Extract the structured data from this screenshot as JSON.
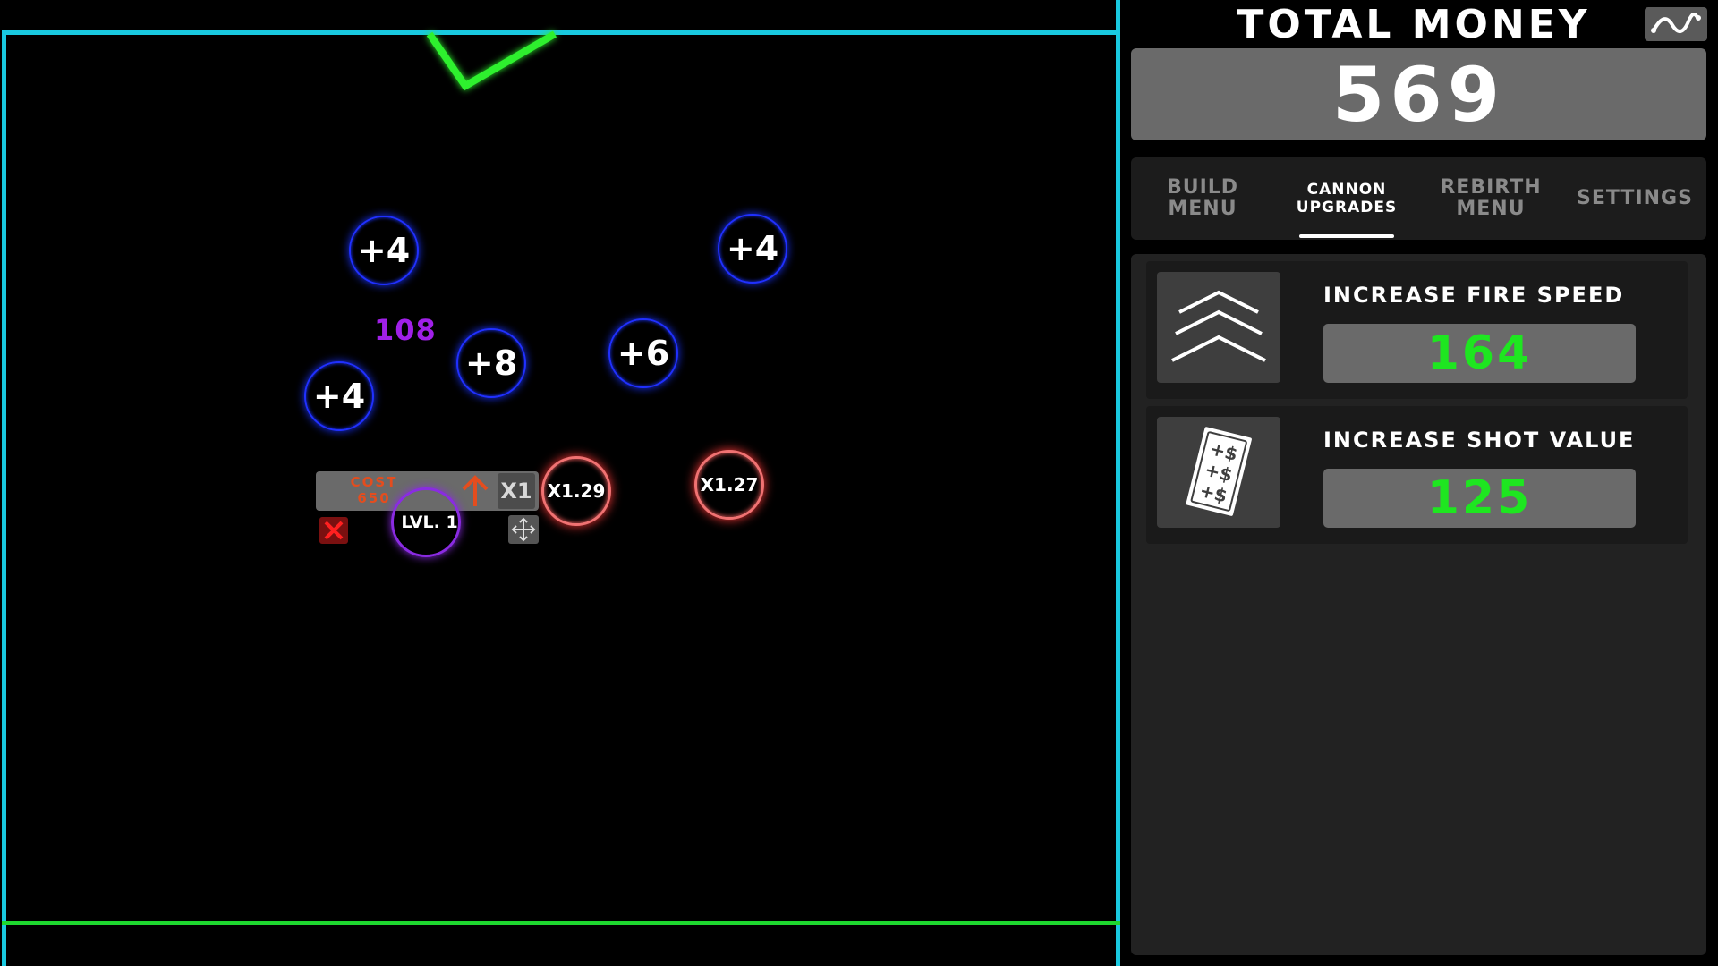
{
  "header": {
    "title": "TOTAL MONEY",
    "money": "569",
    "graph_icon": "stats-graph-icon"
  },
  "tabs": [
    {
      "label_line1": "BUILD",
      "label_line2": "MENU",
      "active": false
    },
    {
      "label_line1": "CANNON",
      "label_line2": "UPGRADES",
      "active": true
    },
    {
      "label_line1": "REBIRTH",
      "label_line2": "MENU",
      "active": false
    },
    {
      "label_line1": "SETTINGS",
      "label_line2": "",
      "active": false
    }
  ],
  "upgrades": [
    {
      "title": "INCREASE FIRE SPEED",
      "price": "164",
      "icon": "triple-chevron-up-icon"
    },
    {
      "title": "INCREASE SHOT VALUE",
      "price": "125",
      "icon": "money-cards-icon"
    }
  ],
  "game": {
    "pegs": [
      "+4",
      "+4",
      "+8",
      "+6",
      "+4"
    ],
    "multipliers": [
      "X1.29",
      "X1.27"
    ],
    "floating_value": "108",
    "cannon": {
      "level_label": "LVL. 1",
      "cost_line1": "COST",
      "cost_line2": "650",
      "buy_amount": "X1"
    }
  },
  "colors": {
    "wall": "#19c9e0",
    "floor": "#1ed82f",
    "peg_ring": "#2030ff",
    "multiplier_ring": "#f07272",
    "cannon_ring": "#8a2be2",
    "price_text": "#1ee620",
    "cost_text": "#e44d1e"
  }
}
